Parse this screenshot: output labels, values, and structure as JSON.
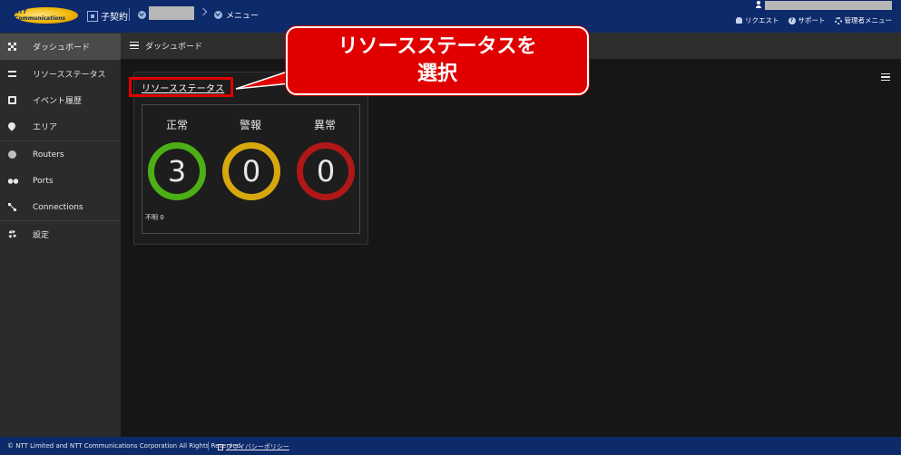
{
  "topbar": {
    "logo_text": "NTT Communications",
    "contract_label": "子契約",
    "breadcrumb_menu": "メニュー",
    "links": [
      {
        "label": "リクエスト",
        "icon": "bell-icon"
      },
      {
        "label": "サポート",
        "icon": "help-icon"
      },
      {
        "label": "管理者メニュー",
        "icon": "gear-icon"
      }
    ]
  },
  "sidebar": {
    "items": [
      {
        "label": "ダッシュボード",
        "icon": "grid-icon",
        "active": true
      },
      {
        "label": "リソースステータス",
        "icon": "list-icon"
      },
      {
        "label": "イベント履歴",
        "icon": "calendar-icon"
      },
      {
        "label": "エリア",
        "icon": "map-pin-icon"
      },
      {
        "label": "Routers",
        "icon": "router-icon"
      },
      {
        "label": "Ports",
        "icon": "ports-icon"
      },
      {
        "label": "Connections",
        "icon": "connections-icon"
      },
      {
        "label": "設定",
        "icon": "settings-icon"
      }
    ]
  },
  "header": {
    "title": "ダッシュボード"
  },
  "widget": {
    "title": "リソースステータス",
    "stats": [
      {
        "label": "正常",
        "value": "3",
        "color": "#4caf16"
      },
      {
        "label": "警報",
        "value": "0",
        "color": "#d7a80e"
      },
      {
        "label": "異常",
        "value": "0",
        "color": "#b01717"
      }
    ],
    "unknown": "不明 0"
  },
  "callout": {
    "line1": "リソースステータスを",
    "line2": "選択"
  },
  "footer": {
    "copyright": "© NTT Limited and NTT Communications Corporation All Rights Reserved.",
    "privacy": "プライバシーポリシー"
  }
}
